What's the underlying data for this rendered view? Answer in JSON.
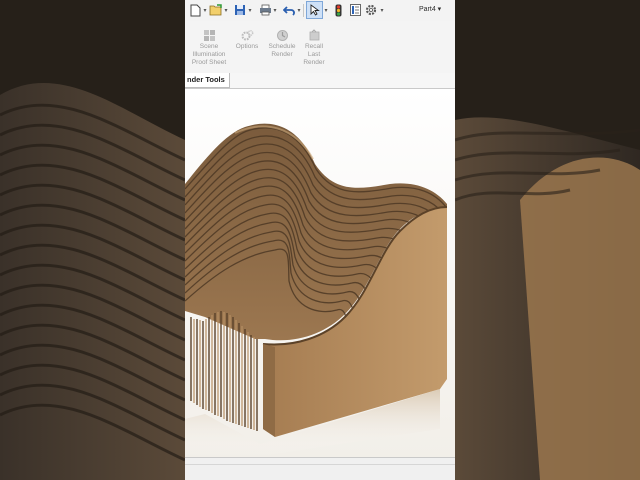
{
  "toolbar": {
    "buttons": [
      "new-document",
      "open",
      "save",
      "print",
      "undo",
      "select",
      "traffic-light",
      "file-properties",
      "options"
    ],
    "document_title": "Part4 ▾"
  },
  "ribbon": {
    "items": [
      {
        "label": "Scene\nIllumination\nProof Sheet",
        "icon": "scene-illumination-icon"
      },
      {
        "label": "Options",
        "icon": "options-icon"
      },
      {
        "label": "Schedule\nRender",
        "icon": "schedule-render-icon"
      },
      {
        "label": "Recall\nLast\nRender",
        "icon": "recall-render-icon"
      }
    ]
  },
  "tab": {
    "label": "nder Tools"
  },
  "colors": {
    "wood": "#b0875a",
    "wood_dark": "#6e5236",
    "background_dark": "#2a2520"
  }
}
